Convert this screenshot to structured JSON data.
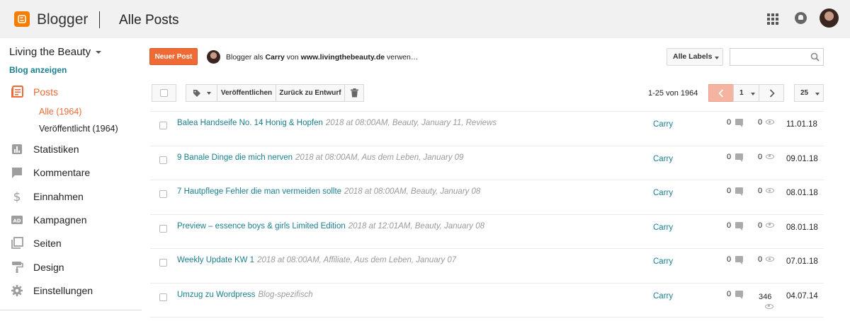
{
  "header": {
    "brand": "Blogger",
    "title": "Alle Posts"
  },
  "sidebar": {
    "blog_name": "Living the Beauty",
    "view_blog": "Blog anzeigen",
    "nav": [
      {
        "label": "Posts",
        "icon": "posts-icon",
        "active": true
      },
      {
        "label": "Statistiken",
        "icon": "stats-icon"
      },
      {
        "label": "Kommentare",
        "icon": "comments-icon"
      },
      {
        "label": "Einnahmen",
        "icon": "dollar-icon"
      },
      {
        "label": "Kampagnen",
        "icon": "ad-icon"
      },
      {
        "label": "Seiten",
        "icon": "pages-icon"
      },
      {
        "label": "Design",
        "icon": "paint-roller-icon"
      },
      {
        "label": "Einstellungen",
        "icon": "gear-icon"
      }
    ],
    "sub": [
      {
        "label": "Alle (1964)",
        "active": true
      },
      {
        "label": "Veröffentlicht (1964)"
      }
    ]
  },
  "toolbar": {
    "new_post": "Neuer Post",
    "user_prefix": "Blogger als ",
    "user_name": "Carry",
    "user_mid": " von ",
    "user_site": "www.livingthebeauty.de",
    "user_suffix": " verwen…",
    "labels": "Alle Labels",
    "search_placeholder": "",
    "publish": "Veröffentlichen",
    "revert": "Zurück zu Entwurf",
    "range": "1-25 von 1964",
    "page": "1",
    "per_page": "25"
  },
  "posts": [
    {
      "title": "Balea Handseife No. 14 Honig & Hopfen",
      "meta": "2018 at 08:00AM, Beauty, January 11, Reviews",
      "author": "Carry",
      "comments": "0",
      "views": "0",
      "date": "11.01.18"
    },
    {
      "title": "9 Banale Dinge die mich nerven",
      "meta": "2018 at 08:00AM, Aus dem Leben, January 09",
      "author": "Carry",
      "comments": "0",
      "views": "0",
      "date": "09.01.18"
    },
    {
      "title": "7 Hautpflege Fehler die man vermeiden sollte",
      "meta": "2018 at 08:00AM, Beauty, January 08",
      "author": "Carry",
      "comments": "0",
      "views": "0",
      "date": "08.01.18"
    },
    {
      "title": "Preview – essence boys & girls Limited Edition",
      "meta": "2018 at 12:01AM, Beauty, January 08",
      "author": "Carry",
      "comments": "0",
      "views": "0",
      "date": "08.01.18"
    },
    {
      "title": "Weekly Update KW 1",
      "meta": "2018 at 08:00AM, Affiliate, Aus dem Leben, January 07",
      "author": "Carry",
      "comments": "0",
      "views": "0",
      "date": "07.01.18"
    },
    {
      "title": "Umzug zu Wordpress",
      "meta": "Blog-spezifisch",
      "author": "Carry",
      "comments": "0",
      "views": "346",
      "date": "04.07.14"
    }
  ]
}
